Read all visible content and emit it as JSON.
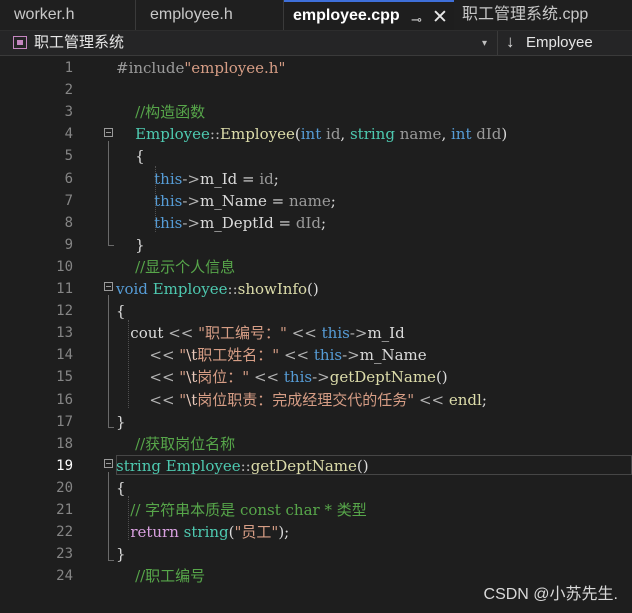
{
  "tabs": [
    {
      "label": "worker.h"
    },
    {
      "label": "employee.h"
    },
    {
      "label": "employee.cpp"
    },
    {
      "label": "职工管理系统.cpp"
    }
  ],
  "tab_icons": {
    "pin": "⊸",
    "close": "✕"
  },
  "navbar": {
    "project": "职工管理系统",
    "dropdown": "▾",
    "member_arrow": "↓",
    "member": "Employee"
  },
  "lines": [
    {
      "n": "1",
      "tokens": [
        {
          "t": "#include",
          "c": "#9b9b9b"
        },
        {
          "t": "\"employee.h\"",
          "c": "#d69d85"
        }
      ]
    },
    {
      "n": "2",
      "tokens": []
    },
    {
      "n": "3",
      "tokens": [
        {
          "t": "    //构造函数",
          "c": "#57a64a"
        }
      ]
    },
    {
      "n": "4",
      "tokens": [
        {
          "t": "    ",
          "c": "#dcdcdc"
        },
        {
          "t": "Employee",
          "c": "#4ec9b0"
        },
        {
          "t": "::",
          "c": "#b4b4b4"
        },
        {
          "t": "Employee",
          "c": "#dcdcaa"
        },
        {
          "t": "(",
          "c": "#dcdcdc"
        },
        {
          "t": "int",
          "c": "#569cd6"
        },
        {
          "t": " ",
          "c": "#dcdcdc"
        },
        {
          "t": "id",
          "c": "#9a9a9a"
        },
        {
          "t": ", ",
          "c": "#dcdcdc"
        },
        {
          "t": "string",
          "c": "#4ec9b0"
        },
        {
          "t": " ",
          "c": "#dcdcdc"
        },
        {
          "t": "name",
          "c": "#9a9a9a"
        },
        {
          "t": ", ",
          "c": "#dcdcdc"
        },
        {
          "t": "int",
          "c": "#569cd6"
        },
        {
          "t": " ",
          "c": "#dcdcdc"
        },
        {
          "t": "dId",
          "c": "#9a9a9a"
        },
        {
          "t": ")",
          "c": "#dcdcdc"
        }
      ]
    },
    {
      "n": "5",
      "tokens": [
        {
          "t": "    {",
          "c": "#dcdcdc"
        }
      ]
    },
    {
      "n": "6",
      "tokens": [
        {
          "t": "        ",
          "c": "#dcdcdc"
        },
        {
          "t": "this",
          "c": "#569cd6"
        },
        {
          "t": "->",
          "c": "#b4b4b4"
        },
        {
          "t": "m_Id",
          "c": "#dadada"
        },
        {
          "t": " = ",
          "c": "#dcdcdc"
        },
        {
          "t": "id",
          "c": "#9a9a9a"
        },
        {
          "t": ";",
          "c": "#dcdcdc"
        }
      ]
    },
    {
      "n": "7",
      "tokens": [
        {
          "t": "        ",
          "c": "#dcdcdc"
        },
        {
          "t": "this",
          "c": "#569cd6"
        },
        {
          "t": "->",
          "c": "#b4b4b4"
        },
        {
          "t": "m_Name",
          "c": "#dadada"
        },
        {
          "t": " = ",
          "c": "#dcdcdc"
        },
        {
          "t": "name",
          "c": "#9a9a9a"
        },
        {
          "t": ";",
          "c": "#dcdcdc"
        }
      ]
    },
    {
      "n": "8",
      "tokens": [
        {
          "t": "        ",
          "c": "#dcdcdc"
        },
        {
          "t": "this",
          "c": "#569cd6"
        },
        {
          "t": "->",
          "c": "#b4b4b4"
        },
        {
          "t": "m_DeptId",
          "c": "#dadada"
        },
        {
          "t": " = ",
          "c": "#dcdcdc"
        },
        {
          "t": "dId",
          "c": "#9a9a9a"
        },
        {
          "t": ";",
          "c": "#dcdcdc"
        }
      ]
    },
    {
      "n": "9",
      "tokens": [
        {
          "t": "    }",
          "c": "#dcdcdc"
        }
      ]
    },
    {
      "n": "10",
      "tokens": [
        {
          "t": "    //显示个人信息",
          "c": "#57a64a"
        }
      ]
    },
    {
      "n": "11",
      "tokens": [
        {
          "t": "void",
          "c": "#569cd6"
        },
        {
          "t": " ",
          "c": "#dcdcdc"
        },
        {
          "t": "Employee",
          "c": "#4ec9b0"
        },
        {
          "t": "::",
          "c": "#b4b4b4"
        },
        {
          "t": "showInfo",
          "c": "#dcdcaa"
        },
        {
          "t": "()",
          "c": "#dcdcdc"
        }
      ]
    },
    {
      "n": "12",
      "tokens": [
        {
          "t": "{",
          "c": "#dcdcdc"
        }
      ]
    },
    {
      "n": "13",
      "tokens": [
        {
          "t": "   cout",
          "c": "#dcdcdc"
        },
        {
          "t": " << ",
          "c": "#b4b4b4"
        },
        {
          "t": "\"职工编号：\"",
          "c": "#d69d85"
        },
        {
          "t": " << ",
          "c": "#b4b4b4"
        },
        {
          "t": "this",
          "c": "#569cd6"
        },
        {
          "t": "->",
          "c": "#b4b4b4"
        },
        {
          "t": "m_Id",
          "c": "#dadada"
        }
      ]
    },
    {
      "n": "14",
      "tokens": [
        {
          "t": "       ",
          "c": "#dcdcdc"
        },
        {
          "t": "<< ",
          "c": "#b4b4b4"
        },
        {
          "t": "\"",
          "c": "#d69d85"
        },
        {
          "t": "\\t",
          "c": "#e8c9bb"
        },
        {
          "t": "职工姓名：\"",
          "c": "#d69d85"
        },
        {
          "t": " << ",
          "c": "#b4b4b4"
        },
        {
          "t": "this",
          "c": "#569cd6"
        },
        {
          "t": "->",
          "c": "#b4b4b4"
        },
        {
          "t": "m_Name",
          "c": "#dadada"
        }
      ]
    },
    {
      "n": "15",
      "tokens": [
        {
          "t": "       ",
          "c": "#dcdcdc"
        },
        {
          "t": "<< ",
          "c": "#b4b4b4"
        },
        {
          "t": "\"",
          "c": "#d69d85"
        },
        {
          "t": "\\t",
          "c": "#e8c9bb"
        },
        {
          "t": "岗位：\"",
          "c": "#d69d85"
        },
        {
          "t": " << ",
          "c": "#b4b4b4"
        },
        {
          "t": "this",
          "c": "#569cd6"
        },
        {
          "t": "->",
          "c": "#b4b4b4"
        },
        {
          "t": "getDeptName",
          "c": "#dcdcaa"
        },
        {
          "t": "()",
          "c": "#dcdcdc"
        }
      ]
    },
    {
      "n": "16",
      "tokens": [
        {
          "t": "       ",
          "c": "#dcdcdc"
        },
        {
          "t": "<< ",
          "c": "#b4b4b4"
        },
        {
          "t": "\"",
          "c": "#d69d85"
        },
        {
          "t": "\\t",
          "c": "#e8c9bb"
        },
        {
          "t": "岗位职责：完成经理交代的任务\"",
          "c": "#d69d85"
        },
        {
          "t": " << ",
          "c": "#b4b4b4"
        },
        {
          "t": "endl",
          "c": "#dcdcaa"
        },
        {
          "t": ";",
          "c": "#dcdcdc"
        }
      ]
    },
    {
      "n": "17",
      "tokens": [
        {
          "t": "}",
          "c": "#dcdcdc"
        }
      ]
    },
    {
      "n": "18",
      "tokens": [
        {
          "t": "    //获取岗位名称",
          "c": "#57a64a"
        }
      ]
    },
    {
      "n": "19",
      "tokens": [
        {
          "t": "string",
          "c": "#4ec9b0"
        },
        {
          "t": " ",
          "c": "#dcdcdc"
        },
        {
          "t": "Employee",
          "c": "#4ec9b0"
        },
        {
          "t": "::",
          "c": "#b4b4b4"
        },
        {
          "t": "getDeptName",
          "c": "#dcdcaa"
        },
        {
          "t": "()",
          "c": "#dcdcdc"
        }
      ]
    },
    {
      "n": "20",
      "tokens": [
        {
          "t": "{",
          "c": "#dcdcdc"
        }
      ]
    },
    {
      "n": "21",
      "tokens": [
        {
          "t": "   // 字符串本质是 const char * 类型",
          "c": "#57a64a"
        }
      ]
    },
    {
      "n": "22",
      "tokens": [
        {
          "t": "   ",
          "c": "#dcdcdc"
        },
        {
          "t": "return",
          "c": "#d8a0df"
        },
        {
          "t": " ",
          "c": "#dcdcdc"
        },
        {
          "t": "string",
          "c": "#4ec9b0"
        },
        {
          "t": "(",
          "c": "#dcdcdc"
        },
        {
          "t": "\"员工\"",
          "c": "#d69d85"
        },
        {
          "t": ");",
          "c": "#dcdcdc"
        }
      ]
    },
    {
      "n": "23",
      "tokens": [
        {
          "t": "}",
          "c": "#dcdcdc"
        }
      ]
    },
    {
      "n": "24",
      "tokens": [
        {
          "t": "    //职工编号",
          "c": "#57a64a"
        }
      ]
    }
  ],
  "current_line": "19",
  "watermark": "CSDN @小苏先生."
}
